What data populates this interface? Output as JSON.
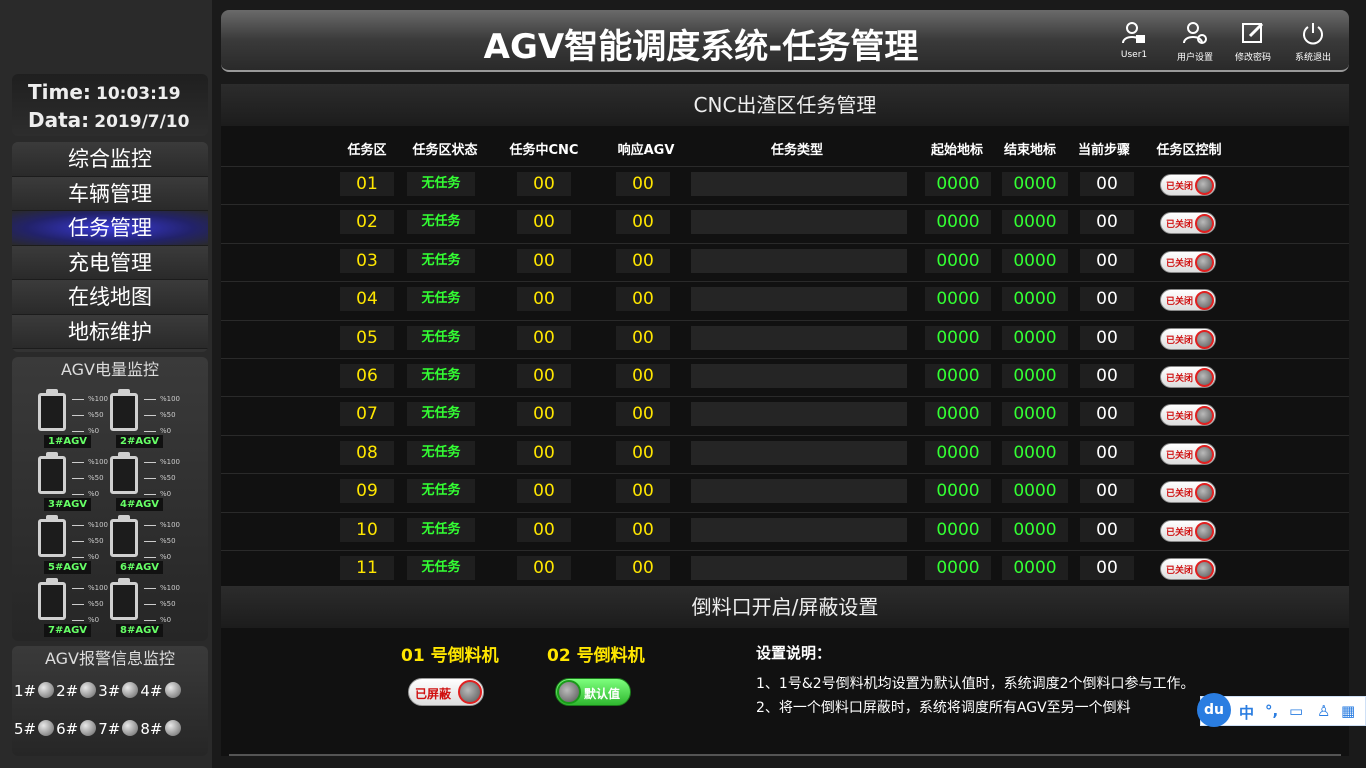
{
  "header": {
    "title": "AGV智能调度系统-任务管理",
    "buttons": [
      {
        "label": "User1",
        "icon": "user-lock-icon"
      },
      {
        "label": "用户设置",
        "icon": "user-settings-icon"
      },
      {
        "label": "修改密码",
        "icon": "edit-password-icon"
      },
      {
        "label": "系统退出",
        "icon": "power-icon"
      }
    ]
  },
  "clock": {
    "time_label": "Time:",
    "time": "10:03:19",
    "date_label": "Data:",
    "date": "2019/7/10"
  },
  "nav": {
    "items": [
      {
        "label": "综合监控",
        "active": false
      },
      {
        "label": "车辆管理",
        "active": false
      },
      {
        "label": "任务管理",
        "active": true
      },
      {
        "label": "充电管理",
        "active": false
      },
      {
        "label": "在线地图",
        "active": false
      },
      {
        "label": "地标维护",
        "active": false
      }
    ]
  },
  "battery": {
    "title": "AGV电量监控",
    "scale": [
      "%100",
      "%50",
      "%0"
    ],
    "agvs": [
      "1#AGV",
      "2#AGV",
      "3#AGV",
      "4#AGV",
      "5#AGV",
      "6#AGV",
      "7#AGV",
      "8#AGV"
    ]
  },
  "alarm": {
    "title": "AGV报警信息监控",
    "items": [
      "1#",
      "2#",
      "3#",
      "4#",
      "5#",
      "6#",
      "7#",
      "8#"
    ]
  },
  "task_section": {
    "title": "CNC出渣区任务管理",
    "columns": [
      "任务区",
      "任务区状态",
      "任务中CNC",
      "响应AGV",
      "任务类型",
      "起始地标",
      "结束地标",
      "当前步骤",
      "任务区控制"
    ],
    "rows": [
      {
        "zone": "01",
        "status": "无任务",
        "cnc": "00",
        "agv": "00",
        "type": "",
        "start": "0000",
        "end": "0000",
        "step": "00",
        "control": "已关闭"
      },
      {
        "zone": "02",
        "status": "无任务",
        "cnc": "00",
        "agv": "00",
        "type": "",
        "start": "0000",
        "end": "0000",
        "step": "00",
        "control": "已关闭"
      },
      {
        "zone": "03",
        "status": "无任务",
        "cnc": "00",
        "agv": "00",
        "type": "",
        "start": "0000",
        "end": "0000",
        "step": "00",
        "control": "已关闭"
      },
      {
        "zone": "04",
        "status": "无任务",
        "cnc": "00",
        "agv": "00",
        "type": "",
        "start": "0000",
        "end": "0000",
        "step": "00",
        "control": "已关闭"
      },
      {
        "zone": "05",
        "status": "无任务",
        "cnc": "00",
        "agv": "00",
        "type": "",
        "start": "0000",
        "end": "0000",
        "step": "00",
        "control": "已关闭"
      },
      {
        "zone": "06",
        "status": "无任务",
        "cnc": "00",
        "agv": "00",
        "type": "",
        "start": "0000",
        "end": "0000",
        "step": "00",
        "control": "已关闭"
      },
      {
        "zone": "07",
        "status": "无任务",
        "cnc": "00",
        "agv": "00",
        "type": "",
        "start": "0000",
        "end": "0000",
        "step": "00",
        "control": "已关闭"
      },
      {
        "zone": "08",
        "status": "无任务",
        "cnc": "00",
        "agv": "00",
        "type": "",
        "start": "0000",
        "end": "0000",
        "step": "00",
        "control": "已关闭"
      },
      {
        "zone": "09",
        "status": "无任务",
        "cnc": "00",
        "agv": "00",
        "type": "",
        "start": "0000",
        "end": "0000",
        "step": "00",
        "control": "已关闭"
      },
      {
        "zone": "10",
        "status": "无任务",
        "cnc": "00",
        "agv": "00",
        "type": "",
        "start": "0000",
        "end": "0000",
        "step": "00",
        "control": "已关闭"
      },
      {
        "zone": "11",
        "status": "无任务",
        "cnc": "00",
        "agv": "00",
        "type": "",
        "start": "0000",
        "end": "0000",
        "step": "00",
        "control": "已关闭"
      }
    ]
  },
  "hopper_section": {
    "title": "倒料口开启/屏蔽设置",
    "hoppers": [
      {
        "label": "01 号倒料机",
        "state": "已屏蔽",
        "on": false
      },
      {
        "label": "02 号倒料机",
        "state": "默认值",
        "on": true
      }
    ],
    "notes_title": "设置说明：",
    "notes": [
      "1、1号&2号倒料机均设置为默认值时，系统调度2个倒料口参与工作。",
      "2、将一个倒料口屏蔽时，系统将调度所有AGV至另一个倒料"
    ]
  },
  "ime": {
    "logo": "du",
    "items": [
      "中",
      "°,",
      "▭",
      "♙",
      "▦"
    ]
  },
  "colors": {
    "value_yellow": "#ffe600",
    "value_green": "#33ff33",
    "nav_active": "#3a3ad8",
    "toggle_off_red": "#e02020"
  }
}
